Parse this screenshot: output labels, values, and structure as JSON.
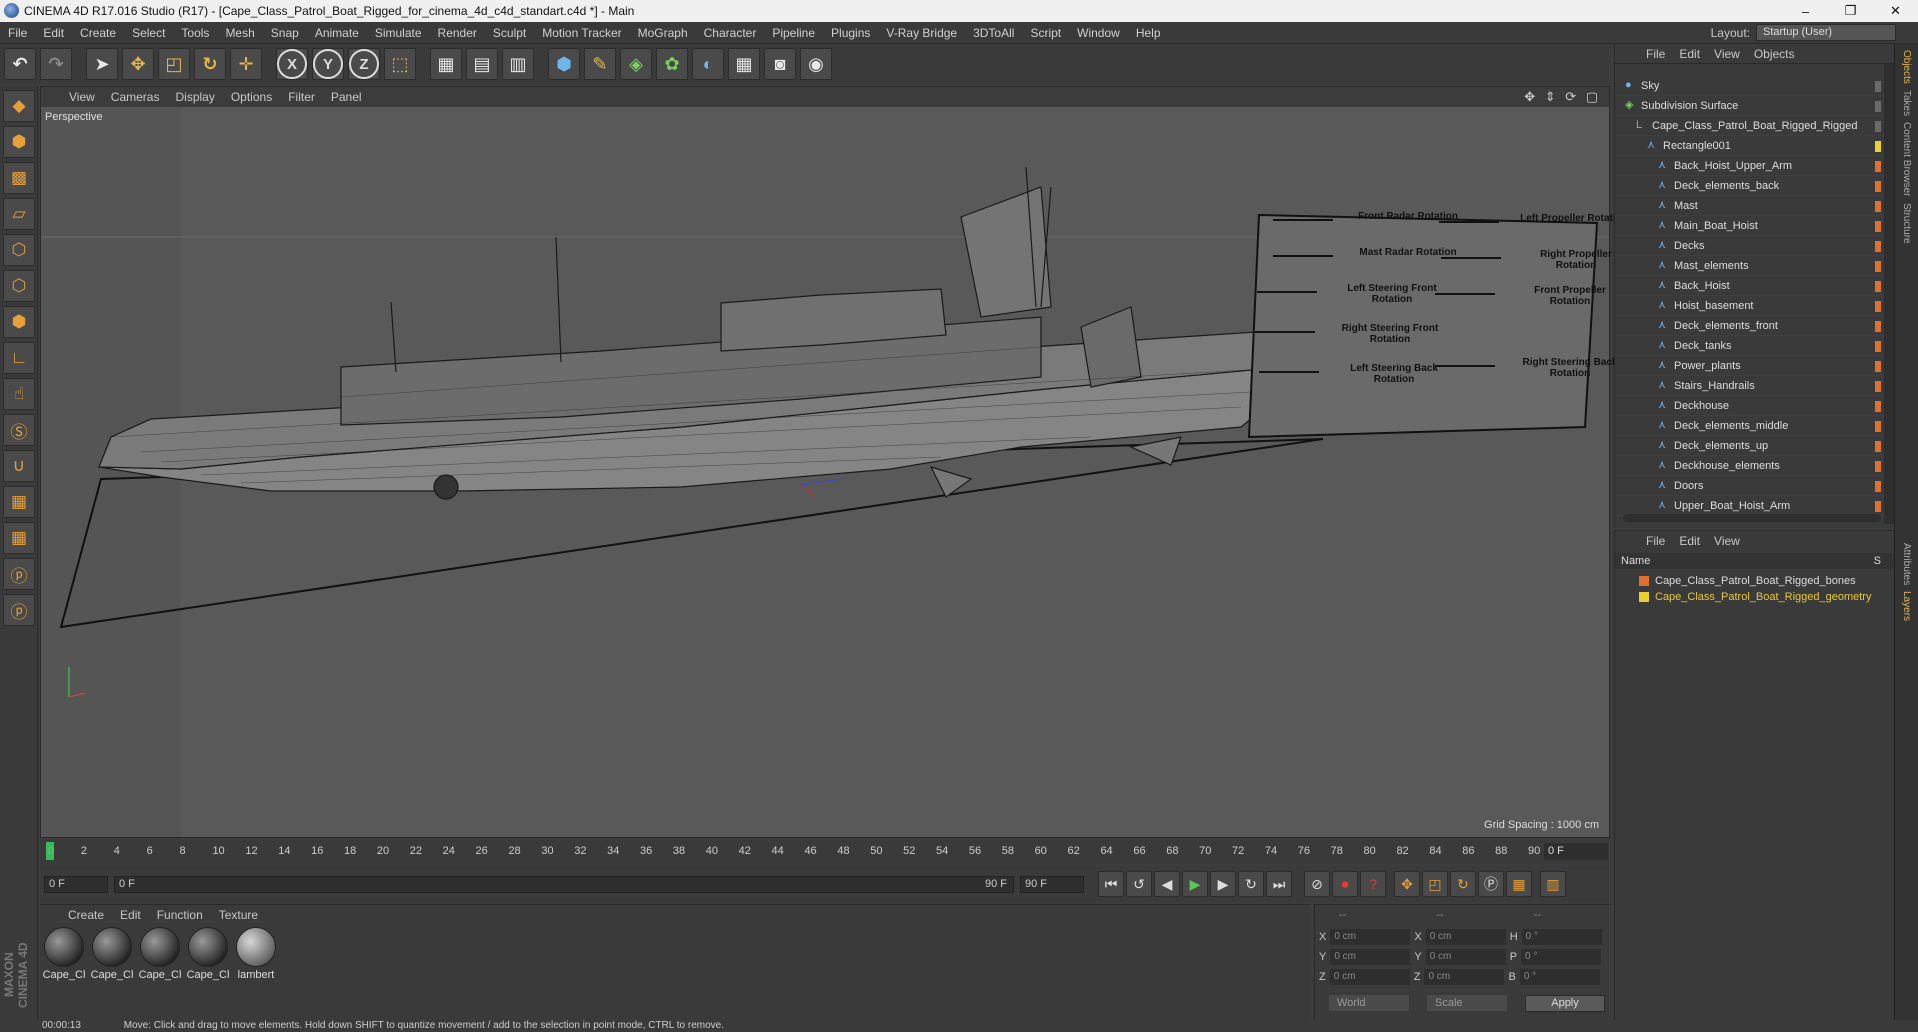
{
  "window": {
    "title": "CINEMA 4D R17.016 Studio (R17) - [Cape_Class_Patrol_Boat_Rigged_for_cinema_4d_c4d_standart.c4d *] - Main",
    "controls": [
      "–",
      "❐",
      "✕"
    ]
  },
  "menubar": {
    "items": [
      "File",
      "Edit",
      "Create",
      "Select",
      "Tools",
      "Mesh",
      "Snap",
      "Animate",
      "Simulate",
      "Render",
      "Sculpt",
      "Motion Tracker",
      "MoGraph",
      "Character",
      "Pipeline",
      "Plugins",
      "V-Ray Bridge",
      "3DToAll",
      "Script",
      "Window",
      "Help"
    ],
    "layout_label": "Layout:",
    "layout_value": "Startup (User)"
  },
  "viewport": {
    "menu": [
      "View",
      "Cameras",
      "Display",
      "Options",
      "Filter",
      "Panel"
    ],
    "camera_label": "Perspective",
    "grid_spacing": "Grid Spacing : 1000 cm",
    "nav_icons": "✥ ⇕ ⟳ ▢"
  },
  "rig_panel": {
    "labels": [
      "Front Radar Rotation",
      "Left Propeller Rotation",
      "Mast Radar Rotation",
      "Right Propeller Rotation",
      "Left Steering Front Rotation",
      "Front Propeller Rotation",
      "Right Steering Front Rotation",
      "Left Steering Back Rotation",
      "Right Steering Back Rotation"
    ]
  },
  "timeline": {
    "ticks": [
      "0",
      "2",
      "4",
      "6",
      "8",
      "10",
      "12",
      "14",
      "16",
      "18",
      "20",
      "22",
      "24",
      "26",
      "28",
      "30",
      "32",
      "34",
      "36",
      "38",
      "40",
      "42",
      "44",
      "46",
      "48",
      "50",
      "52",
      "54",
      "56",
      "58",
      "60",
      "62",
      "64",
      "66",
      "68",
      "70",
      "72",
      "74",
      "76",
      "78",
      "80",
      "82",
      "84",
      "86",
      "88",
      "90"
    ],
    "current_frame": "0 F"
  },
  "transport": {
    "start_field": "0 F",
    "range_start": "0 F",
    "range_end": "90 F",
    "end_field": "90 F"
  },
  "materials": {
    "menu": [
      "Create",
      "Edit",
      "Function",
      "Texture"
    ],
    "items": [
      "Cape_Cl",
      "Cape_Cl",
      "Cape_Cl",
      "Cape_Cl",
      "lambert"
    ]
  },
  "coordinates": {
    "header": [
      "--",
      "--",
      "--"
    ],
    "rows": [
      {
        "a": "X",
        "av": "0 cm",
        "b": "X",
        "bv": "0 cm",
        "c": "H",
        "cv": "0 °"
      },
      {
        "a": "Y",
        "av": "0 cm",
        "b": "Y",
        "bv": "0 cm",
        "c": "P",
        "cv": "0 °"
      },
      {
        "a": "Z",
        "av": "0 cm",
        "b": "Z",
        "bv": "0 cm",
        "c": "B",
        "cv": "0 °"
      }
    ],
    "mode1": "World",
    "mode2": "Scale",
    "apply": "Apply"
  },
  "objects": {
    "menu": [
      "File",
      "Edit",
      "View",
      "Objects"
    ],
    "items": [
      {
        "name": "Sky",
        "indent": 0,
        "tag": "g"
      },
      {
        "name": "Subdivision Surface",
        "indent": 0,
        "tag": "g"
      },
      {
        "name": "Cape_Class_Patrol_Boat_Rigged_Rigged",
        "indent": 1,
        "tag": "g"
      },
      {
        "name": "Rectangle001",
        "indent": 2,
        "tag": "y"
      },
      {
        "name": "Back_Hoist_Upper_Arm",
        "indent": 3,
        "tag": "o"
      },
      {
        "name": "Deck_elements_back",
        "indent": 3,
        "tag": "o"
      },
      {
        "name": "Mast",
        "indent": 3,
        "tag": "o"
      },
      {
        "name": "Main_Boat_Hoist",
        "indent": 3,
        "tag": "o"
      },
      {
        "name": "Decks",
        "indent": 3,
        "tag": "o"
      },
      {
        "name": "Mast_elements",
        "indent": 3,
        "tag": "o"
      },
      {
        "name": "Back_Hoist",
        "indent": 3,
        "tag": "o"
      },
      {
        "name": "Hoist_basement",
        "indent": 3,
        "tag": "o"
      },
      {
        "name": "Deck_elements_front",
        "indent": 3,
        "tag": "o"
      },
      {
        "name": "Deck_tanks",
        "indent": 3,
        "tag": "o"
      },
      {
        "name": "Power_plants",
        "indent": 3,
        "tag": "o"
      },
      {
        "name": "Stairs_Handrails",
        "indent": 3,
        "tag": "o"
      },
      {
        "name": "Deckhouse",
        "indent": 3,
        "tag": "o"
      },
      {
        "name": "Deck_elements_middle",
        "indent": 3,
        "tag": "o"
      },
      {
        "name": "Deck_elements_up",
        "indent": 3,
        "tag": "o"
      },
      {
        "name": "Deckhouse_elements",
        "indent": 3,
        "tag": "o"
      },
      {
        "name": "Doors",
        "indent": 3,
        "tag": "o"
      },
      {
        "name": "Upper_Boat_Hoist_Arm",
        "indent": 3,
        "tag": "o"
      }
    ]
  },
  "layers": {
    "menu": [
      "File",
      "Edit",
      "View"
    ],
    "header": "Name",
    "header_right": "S",
    "items": [
      {
        "name": "Cape_Class_Patrol_Boat_Rigged_bones",
        "color": "#e07030",
        "text_color": "#dddddd"
      },
      {
        "name": "Cape_Class_Patrol_Boat_Rigged_geometry",
        "color": "#e8d030",
        "text_color": "#e8c83a"
      }
    ]
  },
  "side_tabs": [
    "Objects",
    "Takes",
    "Content Browser",
    "Structure",
    "Attributes",
    "Layers"
  ],
  "status": {
    "time": "00:00:13",
    "message": "Move: Click and drag to move elements. Hold down SHIFT to quantize movement / add to the selection in point mode, CTRL to remove."
  },
  "branding": "MAXON CINEMA 4D"
}
